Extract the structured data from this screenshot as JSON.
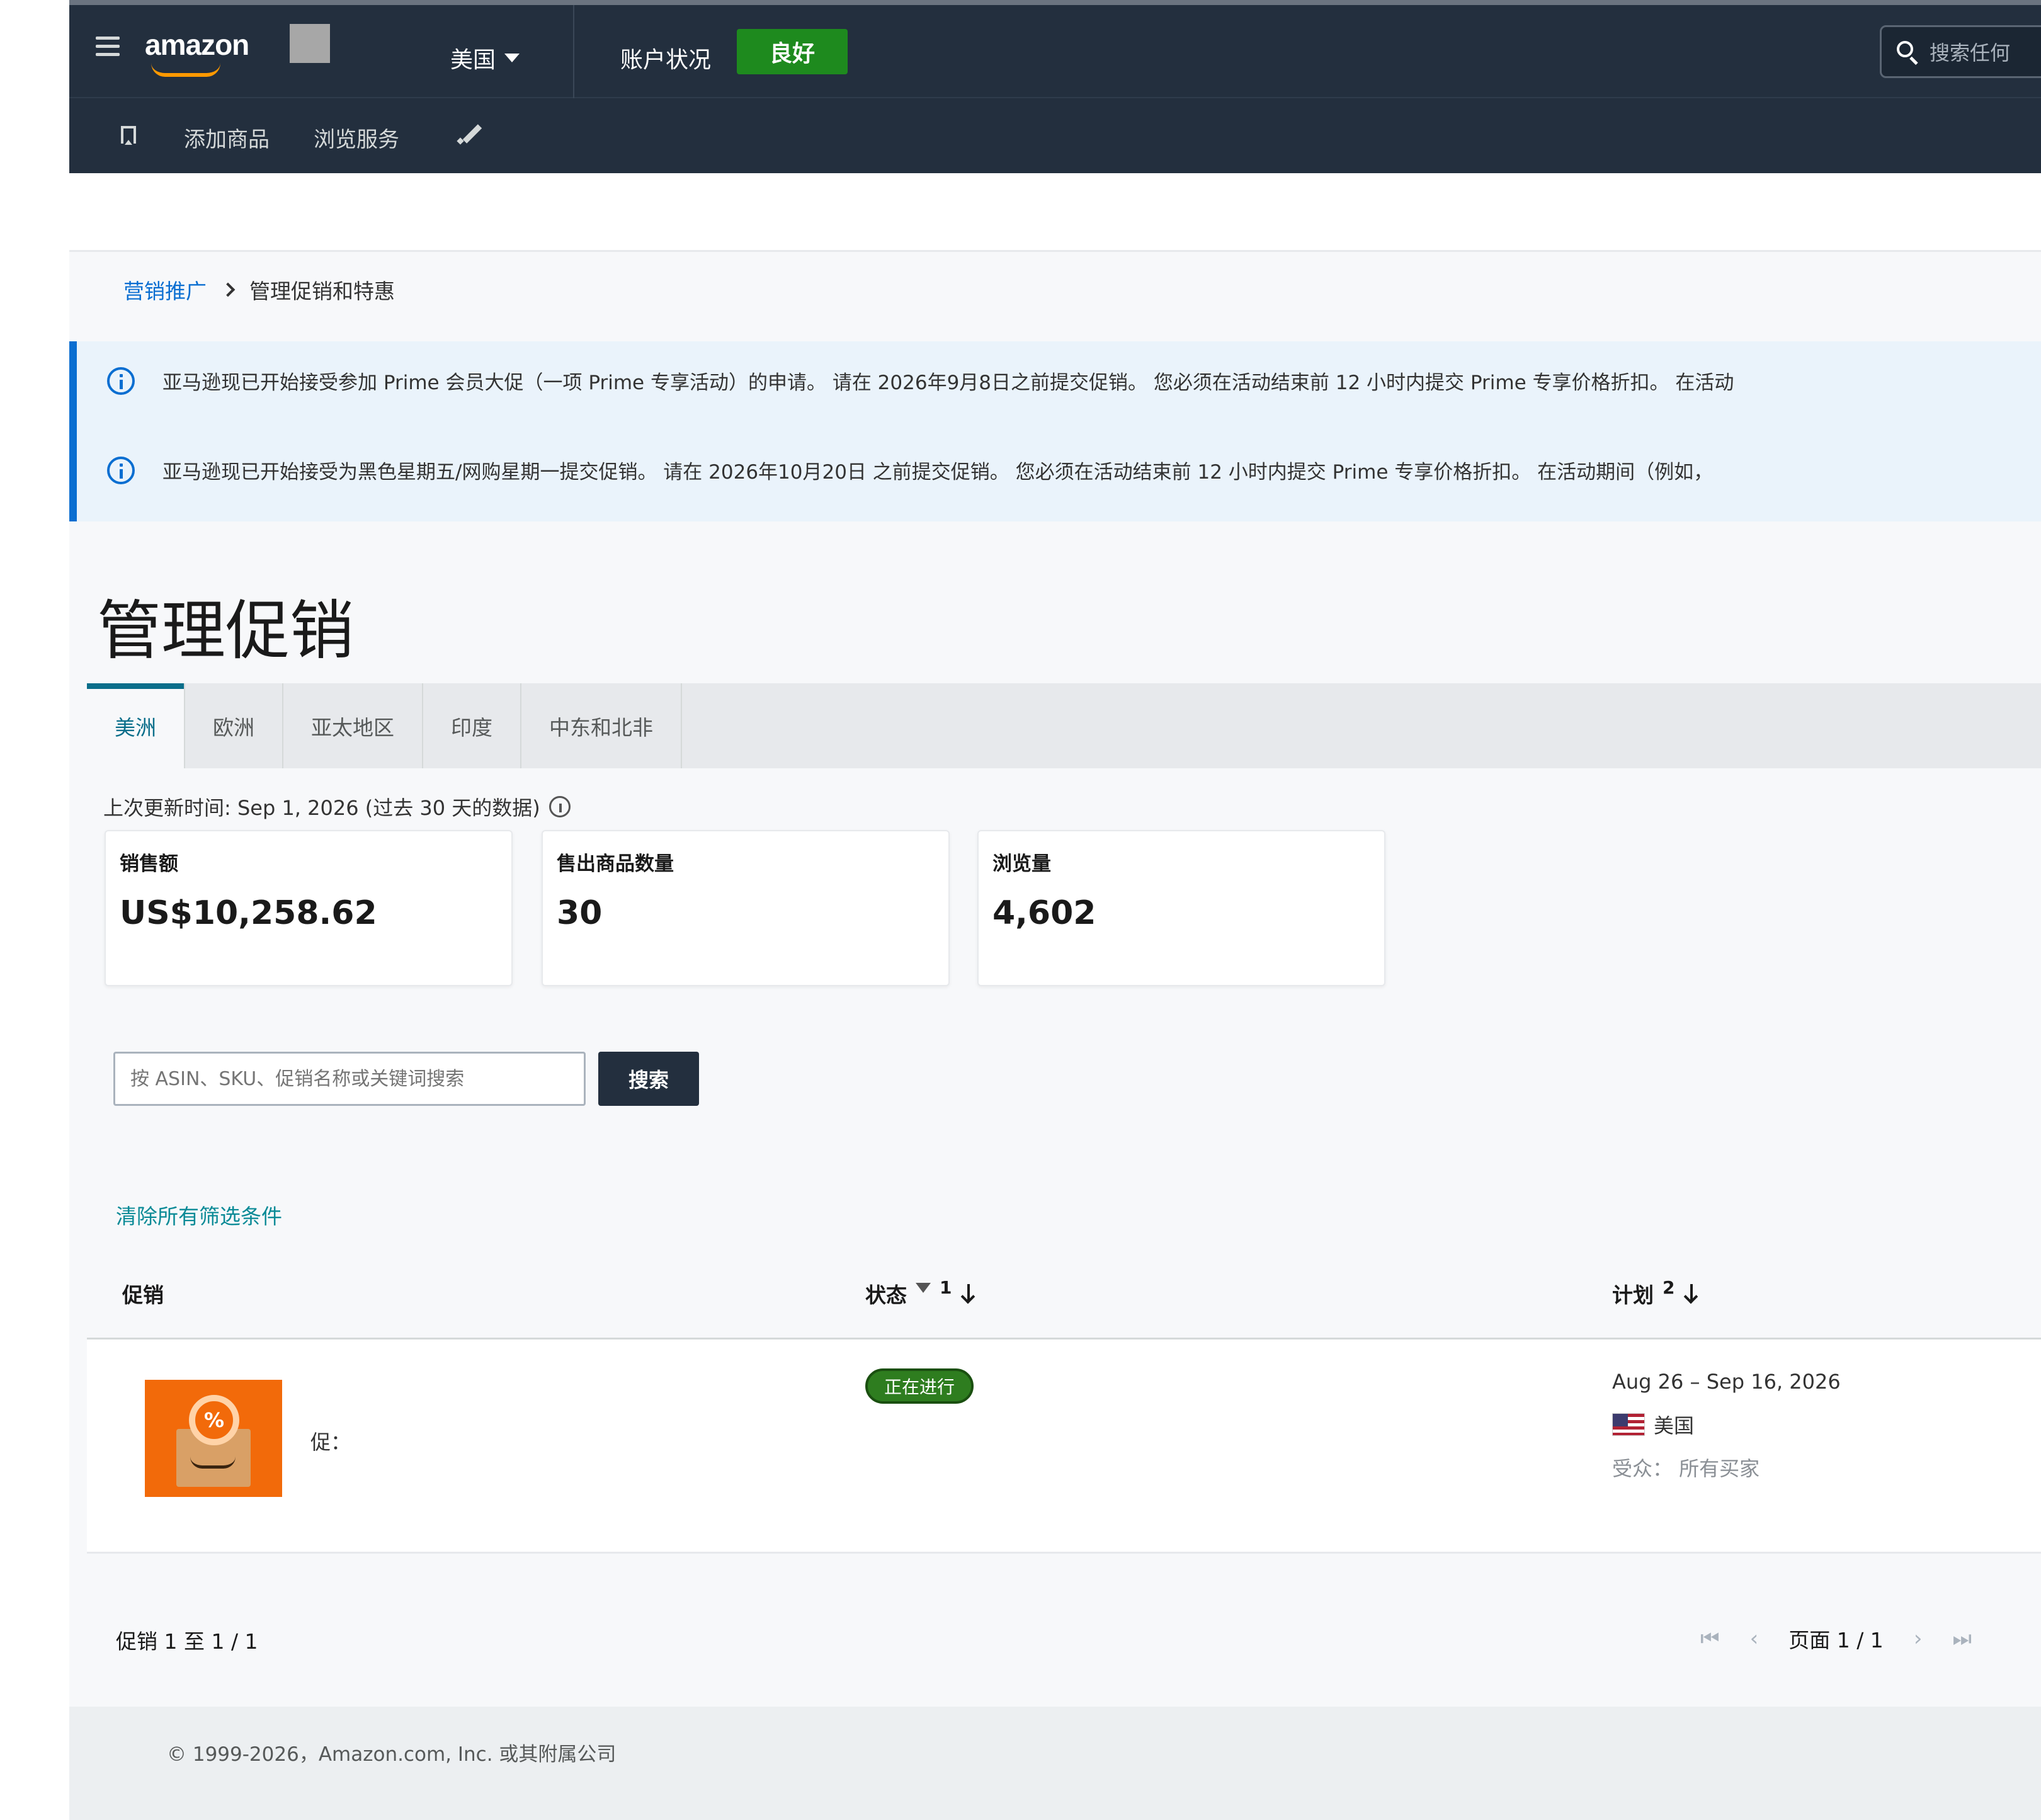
{
  "header": {
    "logo_text": "amazon",
    "region": "美国",
    "account_status_label": "账户状况",
    "account_status_value": "良好",
    "search_placeholder": "搜索任何"
  },
  "subnav": {
    "add_product": "添加商品",
    "browse_services": "浏览服务"
  },
  "breadcrumb": {
    "parent": "营销推广",
    "current": "管理促销和特惠"
  },
  "banners": [
    "亚马逊现已开始接受参加 Prime 会员大促（一项 Prime 专享活动）的申请。 请在 2026年9月8日之前提交促销。 您必须在活动结束前 12 小时内提交 Prime 专享价格折扣。 在活动",
    "亚马逊现已开始接受为黑色星期五/网购星期一提交促销。 请在 2026年10月20日 之前提交促销。 您必须在活动结束前 12 小时内提交 Prime 专享价格折扣。 在活动期间（例如，"
  ],
  "page_title": "管理促销",
  "tabs": [
    "美洲",
    "欧洲",
    "亚太地区",
    "印度",
    "中东和北非"
  ],
  "last_updated": "上次更新时间: Sep 1, 2026 (过去 30 天的数据)",
  "metrics": [
    {
      "label": "销售额",
      "value": "US$10,258.62"
    },
    {
      "label": "售出商品数量",
      "value": "30"
    },
    {
      "label": "浏览量",
      "value": "4,602"
    }
  ],
  "search": {
    "placeholder": "按 ASIN、SKU、促销名称或关键词搜索",
    "button": "搜索"
  },
  "clear_filters": "清除所有筛选条件",
  "table": {
    "col_promo": "促销",
    "col_status": "状态",
    "col_status_sort": "1",
    "col_plan": "计划",
    "col_plan_sort": "2",
    "rows": [
      {
        "name": "促：",
        "thumb_badge": "%",
        "status": "正在进行",
        "dates": "Aug 26 – Sep 16, 2026",
        "region": "美国",
        "audience": "受众：  所有买家"
      }
    ]
  },
  "pagination": {
    "count": "促销 1 至 1 / 1",
    "page": "页面 1 / 1"
  },
  "footer": {
    "copyright": "© 1999-2026，Amazon.com, Inc. 或其附属公司"
  },
  "colors": {
    "topbar": "#232f3e",
    "status_good": "#1e8a1e",
    "link": "#0a6ed1",
    "tab_active": "#0a6e8a",
    "status_active": "#2e7d1f",
    "thumb": "#f26a0a"
  }
}
